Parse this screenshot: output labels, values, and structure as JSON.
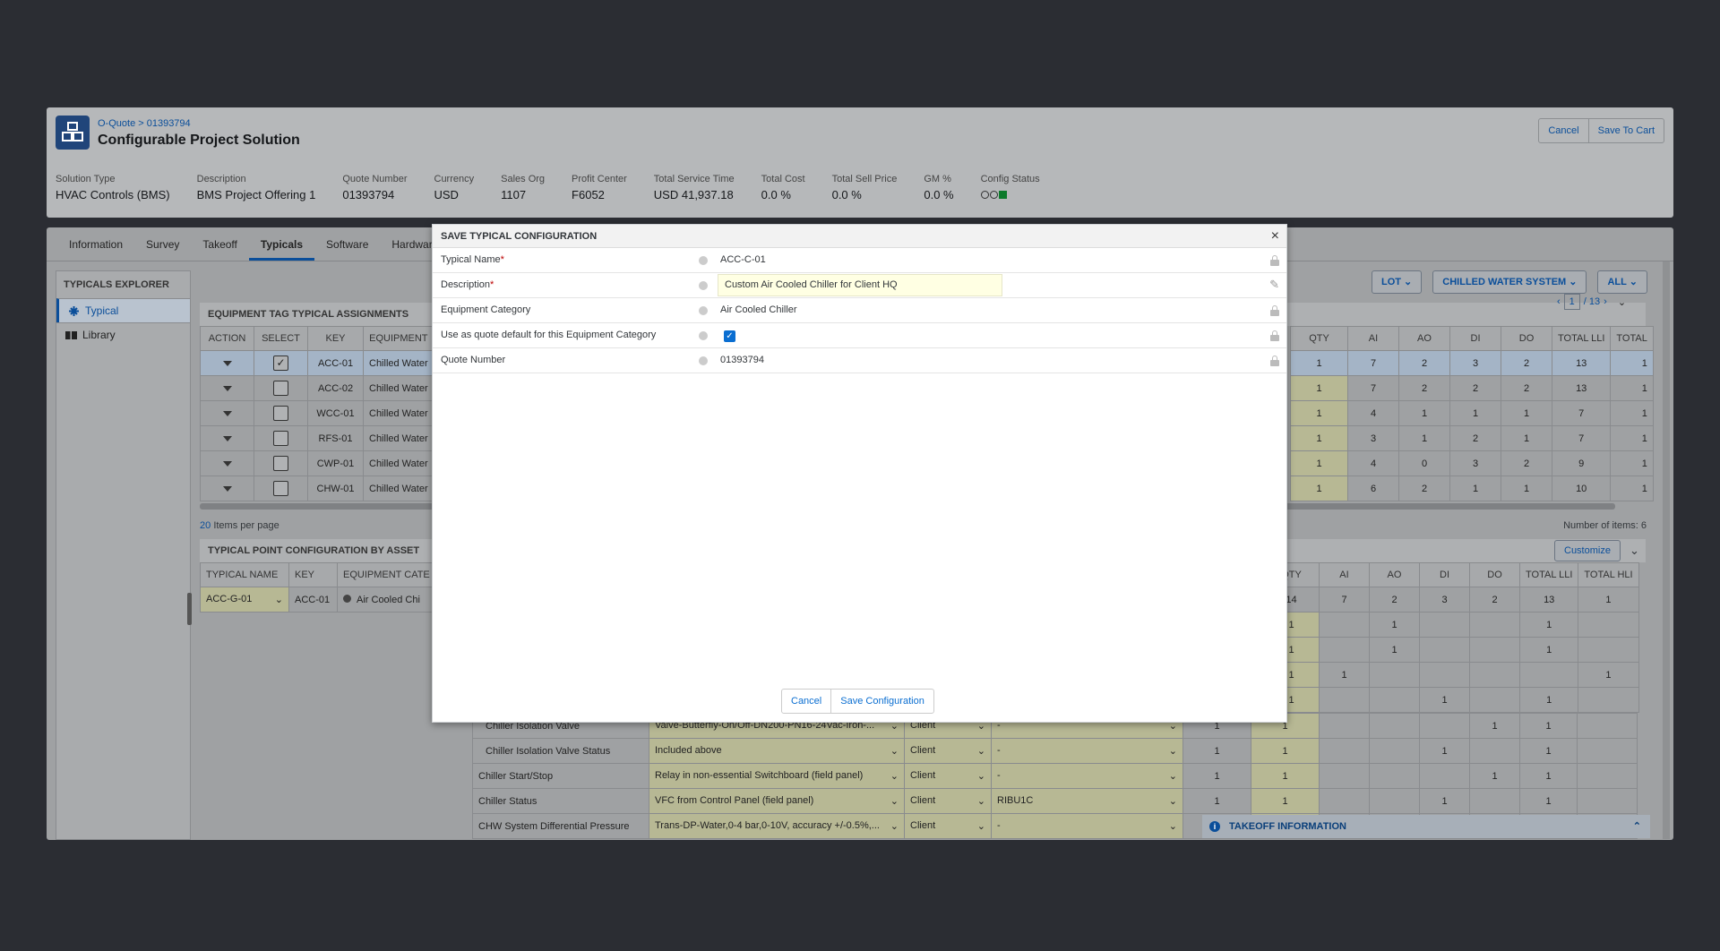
{
  "header": {
    "breadcrumb": "O-Quote > 01393794",
    "title": "Configurable Project Solution",
    "cancel_label": "Cancel",
    "save_cart_label": "Save To Cart"
  },
  "facts": [
    {
      "label": "Solution Type",
      "value": "HVAC Controls (BMS)"
    },
    {
      "label": "Description",
      "value": "BMS Project Offering 1"
    },
    {
      "label": "Quote Number",
      "value": "01393794"
    },
    {
      "label": "Currency",
      "value": "USD"
    },
    {
      "label": "Sales Org",
      "value": "1107"
    },
    {
      "label": "Profit Center",
      "value": "F6052"
    },
    {
      "label": "Total Service Time",
      "value": "USD 41,937.18"
    },
    {
      "label": "Total Cost",
      "value": "0.0 %"
    },
    {
      "label": "Total Sell Price",
      "value": "0.0 %"
    },
    {
      "label": "GM %",
      "value": "0.0 %"
    },
    {
      "label": "Config Status",
      "value": ""
    }
  ],
  "tabs": [
    "Information",
    "Survey",
    "Takeoff",
    "Typicals",
    "Software",
    "Hardware"
  ],
  "sidebar": {
    "title": "TYPICALS EXPLORER",
    "items": [
      "Typical",
      "Library"
    ]
  },
  "filters": {
    "lot": "LOT",
    "system": "CHILLED WATER SYSTEM",
    "all": "ALL"
  },
  "pager": {
    "page": "1",
    "total": "/ 13"
  },
  "assign": {
    "title": "EQUIPMENT TAG TYPICAL ASSIGNMENTS",
    "cols_left": [
      "ACTION",
      "SELECT",
      "KEY",
      "EQUIPMENT"
    ],
    "cols_right": [
      "QTY",
      "AI",
      "AO",
      "DI",
      "DO",
      "TOTAL LLI",
      "TOTAL"
    ],
    "rows": [
      {
        "key": "ACC-01",
        "eq": "Chilled Water",
        "qty": "1",
        "ai": "7",
        "ao": "2",
        "di": "3",
        "do": "2",
        "lli": "13",
        "tot": "1",
        "sel": true
      },
      {
        "key": "ACC-02",
        "eq": "Chilled Water",
        "qty": "1",
        "ai": "7",
        "ao": "2",
        "di": "2",
        "do": "2",
        "lli": "13",
        "tot": "1",
        "sel": false
      },
      {
        "key": "WCC-01",
        "eq": "Chilled Water",
        "qty": "1",
        "ai": "4",
        "ao": "1",
        "di": "1",
        "do": "1",
        "lli": "7",
        "tot": "1",
        "sel": false
      },
      {
        "key": "RFS-01",
        "eq": "Chilled Water",
        "qty": "1",
        "ai": "3",
        "ao": "1",
        "di": "2",
        "do": "1",
        "lli": "7",
        "tot": "1",
        "sel": false
      },
      {
        "key": "CWP-01",
        "eq": "Chilled Water",
        "qty": "1",
        "ai": "4",
        "ao": "0",
        "di": "3",
        "do": "2",
        "lli": "9",
        "tot": "1",
        "sel": false
      },
      {
        "key": "CHW-01",
        "eq": "Chilled Water",
        "qty": "1",
        "ai": "6",
        "ao": "2",
        "di": "1",
        "do": "1",
        "lli": "10",
        "tot": "1",
        "sel": false
      }
    ],
    "items_per_page": "20",
    "items_per_page_label": "Items per page",
    "count_label": "Number of items: 6"
  },
  "point": {
    "title": "TYPICAL POINT CONFIGURATION BY ASSET",
    "customize": "Customize",
    "cols_left": [
      "TYPICAL NAME",
      "KEY",
      "EQUIPMENT CATE"
    ],
    "cols_right": [
      "QTY",
      "AI",
      "AO",
      "DI",
      "DO",
      "TOTAL LLI",
      "TOTAL HLI"
    ],
    "first": {
      "name": "ACC-G-01",
      "key": "ACC-01",
      "cat": "Air Cooled Chi",
      "qty": "14",
      "ai": "7",
      "ao": "2",
      "di": "3",
      "do": "2",
      "lli": "13",
      "hli": "1"
    },
    "rows": [
      {
        "name": "Chiller Isolation Valve",
        "dev": "Valve-Butterfly-On/Off-DN200-PN16-24Vac-Iron-...",
        "sup": "Client",
        "tag": "-",
        "q1": "1",
        "q2": "1",
        "ai": "",
        "ao": "",
        "di": "",
        "do": "1",
        "lli": "1",
        "hli": ""
      },
      {
        "name": "Chiller Isolation Valve Status",
        "dev": "Included above",
        "sup": "Client",
        "tag": "-",
        "q1": "1",
        "q2": "1",
        "ai": "",
        "ao": "",
        "di": "1",
        "do": "",
        "lli": "1",
        "hli": ""
      },
      {
        "name": "Chiller Start/Stop",
        "dev": "Relay in non-essential Switchboard (field panel)",
        "sup": "Client",
        "tag": "-",
        "q1": "1",
        "q2": "1",
        "ai": "",
        "ao": "",
        "di": "",
        "do": "1",
        "lli": "1",
        "hli": ""
      },
      {
        "name": "Chiller Status",
        "dev": "VFC from Control Panel (field panel)",
        "sup": "Client",
        "tag": "RIBU1C",
        "q1": "1",
        "q2": "1",
        "ai": "",
        "ao": "",
        "di": "1",
        "do": "",
        "lli": "1",
        "hli": ""
      },
      {
        "name": "CHW System Differential Pressure",
        "dev": "Trans-DP-Water,0-4 bar,0-10V, accuracy +/-0.5%,...",
        "sup": "Client",
        "tag": "-",
        "q1": "1",
        "q2": "1",
        "ai": "",
        "ao": "",
        "di": "",
        "do": "",
        "lli": "",
        "hli": ""
      }
    ],
    "partial": [
      {
        "q": "1",
        "ai": "",
        "ao": "1",
        "di": "",
        "do": "",
        "lli": "1",
        "hli": ""
      },
      {
        "q": "1",
        "ai": "",
        "ao": "1",
        "di": "",
        "do": "",
        "lli": "1",
        "hli": ""
      },
      {
        "q": "1",
        "ai": "1",
        "ao": "",
        "di": "",
        "do": "",
        "lli": "",
        "hli": "1"
      },
      {
        "q": "1",
        "ai": "",
        "ao": "",
        "di": "1",
        "do": "",
        "lli": "1",
        "hli": ""
      }
    ]
  },
  "takeoff": "TAKEOFF INFORMATION",
  "dialog": {
    "title": "SAVE TYPICAL CONFIGURATION",
    "fields": [
      {
        "label": "Typical Name",
        "required": "*",
        "value": "ACC-C-01"
      },
      {
        "label": "Description",
        "required": "*",
        "value": "Custom Air Cooled Chiller for Client HQ"
      },
      {
        "label": "Equipment Category",
        "required": "",
        "value": "Air Cooled Chiller"
      },
      {
        "label": "Use as quote default for this Equipment Category",
        "required": "",
        "value": ""
      },
      {
        "label": "Quote Number",
        "required": "",
        "value": "01393794"
      }
    ],
    "cancel": "Cancel",
    "save": "Save Configuration"
  },
  "colors": {
    "accent": "#0a6ed1",
    "brand": "#20457a"
  }
}
